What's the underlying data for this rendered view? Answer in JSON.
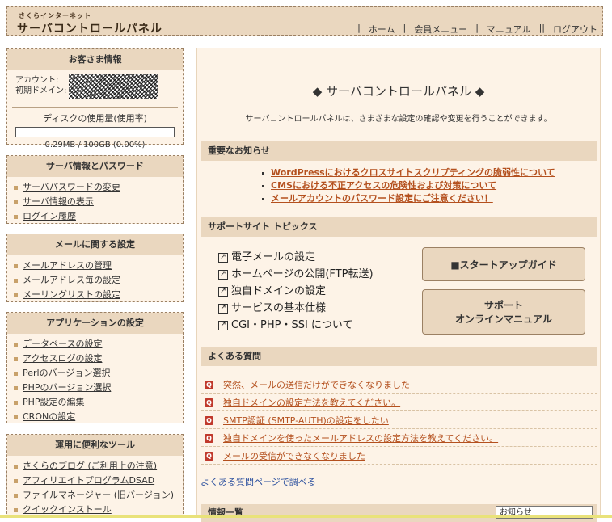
{
  "header": {
    "logo_sub": "さくらインターネット",
    "logo_main": "サーバコントロールパネル",
    "nav": [
      "ホーム",
      "会員メニュー",
      "マニュアル",
      "ログアウト"
    ]
  },
  "customer": {
    "title": "お客さま情報",
    "account_label": "アカウント:",
    "domain_label": "初期ドメイン:",
    "disk_title": "ディスクの使用量(使用率)",
    "disk_usage_fraction": 0.0,
    "disk_value": "0.29MB / 100GB (0.00%)"
  },
  "server_info": {
    "title": "サーバ情報とパスワード",
    "items": [
      "サーバパスワードの変更",
      "サーバ情報の表示",
      "ログイン履歴"
    ]
  },
  "mail": {
    "title": "メールに関する設定",
    "items": [
      "メールアドレスの管理",
      "メールアドレス毎の設定",
      "メーリングリストの設定"
    ]
  },
  "apps": {
    "title": "アプリケーションの設定",
    "items": [
      "データベースの設定",
      "アクセスログの設定",
      "Perlのバージョン選択",
      "PHPのバージョン選択",
      "PHP設定の編集",
      "CRONの設定"
    ]
  },
  "tools": {
    "title": "運用に便利なツール",
    "items": [
      "さくらのブログ (ご利用上の注意)",
      "アフィリエイトプログラムDSAD",
      "ファイルマネージャー (旧バージョン)",
      "クイックインストール"
    ]
  },
  "main": {
    "title": "◆ サーバコントロールパネル ◆",
    "subtitle": "サーバコントロールパネルは、さまざまな設定の確認や変更を行うことができます。",
    "notice_title": "重要なお知らせ",
    "notices": [
      "WordPressにおけるクロスサイトスクリプティングの脆弱性について",
      "CMSにおける不正アクセスの危険性および対策について",
      "メールアカウントのパスワード設定にご注意ください！"
    ],
    "support_title": "サポートサイト トピックス",
    "topics": [
      "電子メールの設定",
      "ホームページの公開(FTP転送)",
      "独自ドメインの設定",
      "サービスの基本仕様",
      "CGI・PHP・SSI について"
    ],
    "startup_button": "スタートアップガイド",
    "online_manual_line1": "サポート",
    "online_manual_line2": "オンラインマニュアル",
    "faq_title": "よくある質問",
    "faqs": [
      "突然、メールの送信だけができなくなりました",
      "独自ドメインの設定方法を教えてください。",
      "SMTP認証 (SMTP-AUTH)の設定をしたい",
      "独自ドメインを使ったメールアドレスの設定方法を教えてください。",
      "メールの受信ができなくなりました"
    ],
    "faq_more": "よくある質問ページで調べる",
    "info_title": "情報一覧",
    "info_select": "お知らせ"
  }
}
